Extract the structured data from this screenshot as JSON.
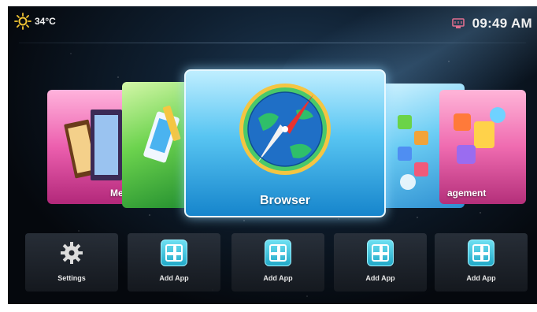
{
  "status": {
    "temperature": "34°C",
    "time": "09:49 AM",
    "weather_icon": "sun-icon",
    "network_icon": "ethernet-icon"
  },
  "carousel": {
    "focused": "Browser",
    "cards": [
      {
        "id": "media",
        "label_partial": "Me"
      },
      {
        "id": "app",
        "label_partial": ""
      },
      {
        "id": "browser",
        "label": "Browser"
      },
      {
        "id": "file",
        "label_partial": ""
      },
      {
        "id": "manage",
        "label_partial": "agement"
      }
    ]
  },
  "dock": {
    "tiles": [
      {
        "label": "Settings",
        "icon": "gear-icon"
      },
      {
        "label": "Add App",
        "icon": "add-app-icon"
      },
      {
        "label": "Add App",
        "icon": "add-app-icon"
      },
      {
        "label": "Add App",
        "icon": "add-app-icon"
      },
      {
        "label": "Add App",
        "icon": "add-app-icon"
      }
    ]
  },
  "colors": {
    "accent": "#22a9c8",
    "browser_card": "#58c5f2",
    "background": "#05080d"
  }
}
